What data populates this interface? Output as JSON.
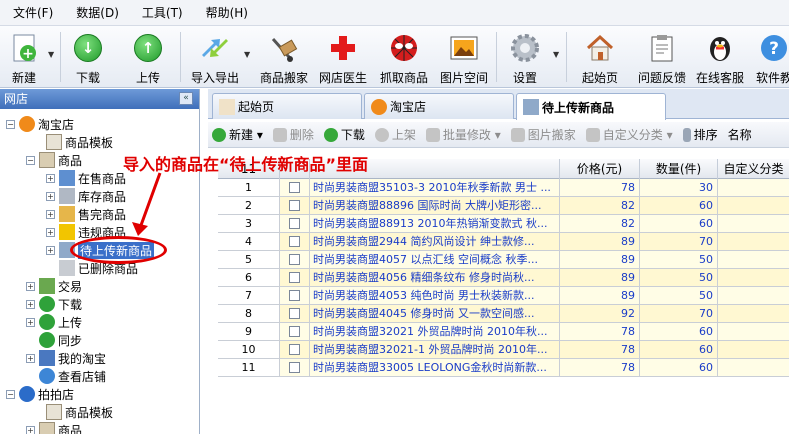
{
  "menu": [
    "文件(F)",
    "数据(D)",
    "工具(T)",
    "帮助(H)"
  ],
  "toolbar": [
    {
      "label": "新建",
      "icon": "new-file-icon"
    },
    {
      "label": "下载",
      "icon": "download-icon"
    },
    {
      "label": "上传",
      "icon": "upload-icon"
    },
    {
      "label": "导入导出",
      "icon": "import-export-icon"
    },
    {
      "label": "商品搬家",
      "icon": "move-product-icon"
    },
    {
      "label": "网店医生",
      "icon": "doctor-cross-icon"
    },
    {
      "label": "抓取商品",
      "icon": "spider-icon"
    },
    {
      "label": "图片空间",
      "icon": "picture-space-icon"
    },
    {
      "label": "设置",
      "icon": "gear-icon"
    },
    {
      "label": "起始页",
      "icon": "home-icon"
    },
    {
      "label": "问题反馈",
      "icon": "clipboard-icon"
    },
    {
      "label": "在线客服",
      "icon": "qq-penguin-icon"
    },
    {
      "label": "软件教",
      "icon": "help-icon"
    }
  ],
  "left_panel": {
    "title": "网店",
    "tree": [
      {
        "label": "淘宝店"
      },
      {
        "label": "商品模板"
      },
      {
        "label": "商品"
      },
      {
        "label": "在售商品"
      },
      {
        "label": "库存商品"
      },
      {
        "label": "售完商品"
      },
      {
        "label": "违规商品"
      },
      {
        "label": "待上传新商品"
      },
      {
        "label": "已删除商品"
      },
      {
        "label": "交易"
      },
      {
        "label": "下载"
      },
      {
        "label": "上传"
      },
      {
        "label": "同步"
      },
      {
        "label": "我的淘宝"
      },
      {
        "label": "查看店铺"
      },
      {
        "label": "拍拍店"
      },
      {
        "label": "商品模板"
      },
      {
        "label": "商品"
      }
    ]
  },
  "tabs": [
    "起始页",
    "淘宝店",
    "待上传新商品"
  ],
  "subtoolbar": [
    {
      "label": "新建",
      "enabled": true
    },
    {
      "label": "删除",
      "enabled": false
    },
    {
      "label": "下载",
      "enabled": true
    },
    {
      "label": "上架",
      "enabled": false
    },
    {
      "label": "批量修改",
      "enabled": false
    },
    {
      "label": "图片搬家",
      "enabled": false
    },
    {
      "label": "自定义分类",
      "enabled": false
    },
    {
      "label": "排序",
      "enabled": true
    },
    {
      "label": "名称",
      "enabled": true
    }
  ],
  "grid": {
    "count": "11",
    "columns": [
      "",
      "",
      "",
      "价格(元)",
      "数量(件)",
      "自定义分类"
    ],
    "rows": [
      {
        "n": "1",
        "title": "时尚男装商盟35103-3 2010年秋季新款 男士 ...",
        "price": "78",
        "qty": "30"
      },
      {
        "n": "2",
        "title": "时尚男装商盟88896 国际时尚 大牌小矩形密...",
        "price": "82",
        "qty": "60"
      },
      {
        "n": "3",
        "title": "时尚男装商盟88913 2010年热销渐变款式 秋...",
        "price": "82",
        "qty": "60"
      },
      {
        "n": "4",
        "title": "时尚男装商盟2944 简约风尚设计 绅士款修...",
        "price": "89",
        "qty": "70"
      },
      {
        "n": "5",
        "title": "时尚男装商盟4057 以点汇线 空间概念 秋季...",
        "price": "89",
        "qty": "50"
      },
      {
        "n": "6",
        "title": "时尚男装商盟4056 精细条纹布 修身时尚秋...",
        "price": "89",
        "qty": "50"
      },
      {
        "n": "7",
        "title": "时尚男装商盟4053 纯色时尚 男士秋装新款...",
        "price": "89",
        "qty": "50"
      },
      {
        "n": "8",
        "title": "时尚男装商盟4045 修身时尚 又一款空间感...",
        "price": "92",
        "qty": "70"
      },
      {
        "n": "9",
        "title": "时尚男装商盟32021 外贸品牌时尚 2010年秋...",
        "price": "78",
        "qty": "60"
      },
      {
        "n": "10",
        "title": "时尚男装商盟32021-1 外贸品牌时尚 2010年...",
        "price": "78",
        "qty": "60"
      },
      {
        "n": "11",
        "title": "时尚男装商盟33005 LEOLONG金秋时尚新款...",
        "price": "78",
        "qty": "60"
      }
    ]
  },
  "annotation": "导入的商品在“待上传新商品”里面",
  "colors": {
    "accent_red": "#e00000",
    "link_blue": "#1a3cc8",
    "header_blue": "#3f6fba"
  }
}
